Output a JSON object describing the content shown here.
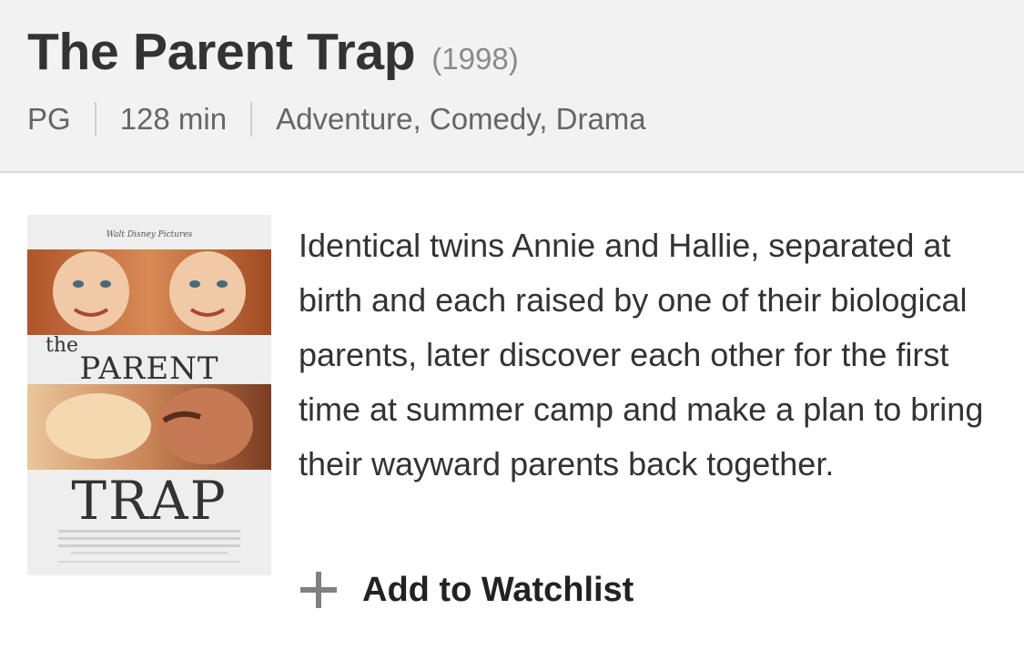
{
  "movie": {
    "title": "The Parent Trap",
    "year": "(1998)",
    "rating": "PG",
    "runtime": "128 min",
    "genres": "Adventure, Comedy, Drama",
    "plot": "Identical twins Annie and Hallie, separated at birth and each raised by one of their biological parents, later discover each other for the first time at summer camp and make a plan to bring their wayward parents back together."
  },
  "poster": {
    "studio": "Walt Disney Pictures",
    "title_the": "the",
    "title_parent": "PARENT",
    "title_trap": "TRAP"
  },
  "actions": {
    "watchlist_label": "Add to Watchlist",
    "watchlist_icon": "plus-icon"
  },
  "colors": {
    "header_bg": "#f2f2f2",
    "title_text": "#333333",
    "muted_text": "#8a8a8a",
    "plus_icon": "#808080"
  }
}
